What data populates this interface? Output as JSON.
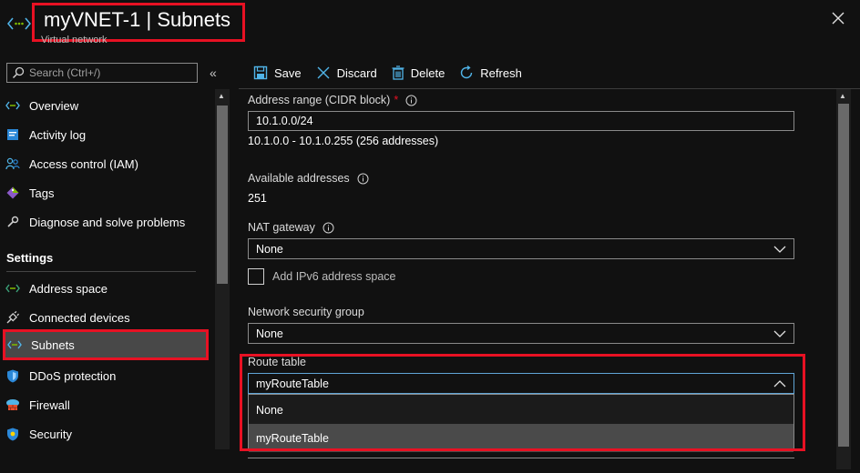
{
  "header": {
    "title": "myVNET-1",
    "separator": "|",
    "title_section": "Subnets",
    "subtitle": "Virtual network",
    "icon": "virtual-network-icon",
    "close_icon": "close-icon"
  },
  "sidebar": {
    "search_placeholder": "Search (Ctrl+/)",
    "collapse_glyph": "«",
    "items": [
      {
        "label": "Overview",
        "icon": "overview-icon"
      },
      {
        "label": "Activity log",
        "icon": "activity-log-icon"
      },
      {
        "label": "Access control (IAM)",
        "icon": "access-control-icon"
      },
      {
        "label": "Tags",
        "icon": "tag-icon"
      },
      {
        "label": "Diagnose and solve problems",
        "icon": "wrench-icon"
      }
    ],
    "section_label": "Settings",
    "settings_items": [
      {
        "label": "Address space",
        "icon": "address-space-icon"
      },
      {
        "label": "Connected devices",
        "icon": "plug-icon"
      },
      {
        "label": "Subnets",
        "icon": "subnet-icon",
        "selected": true
      },
      {
        "label": "DDoS protection",
        "icon": "shield-icon"
      },
      {
        "label": "Firewall",
        "icon": "firewall-icon"
      },
      {
        "label": "Security",
        "icon": "security-shield-icon"
      }
    ]
  },
  "toolbar": {
    "save_label": "Save",
    "discard_label": "Discard",
    "delete_label": "Delete",
    "refresh_label": "Refresh"
  },
  "form": {
    "address_range_label": "Address range (CIDR block)",
    "address_range_required": "*",
    "address_range_value": "10.1.0.0/24",
    "address_range_hint": "10.1.0.0 - 10.1.0.255 (256 addresses)",
    "available_label": "Available addresses",
    "available_value": "251",
    "nat_label": "NAT gateway",
    "nat_value": "None",
    "ipv6_label": "Add IPv6 address space",
    "nsg_label": "Network security group",
    "nsg_value": "None",
    "route_label": "Route table",
    "route_value": "myRouteTable",
    "route_options": [
      "None",
      "myRouteTable"
    ]
  },
  "colors": {
    "background": "#111111",
    "highlight": "#e81123",
    "accent": "#60a5d6",
    "selected_bg": "#484848"
  }
}
